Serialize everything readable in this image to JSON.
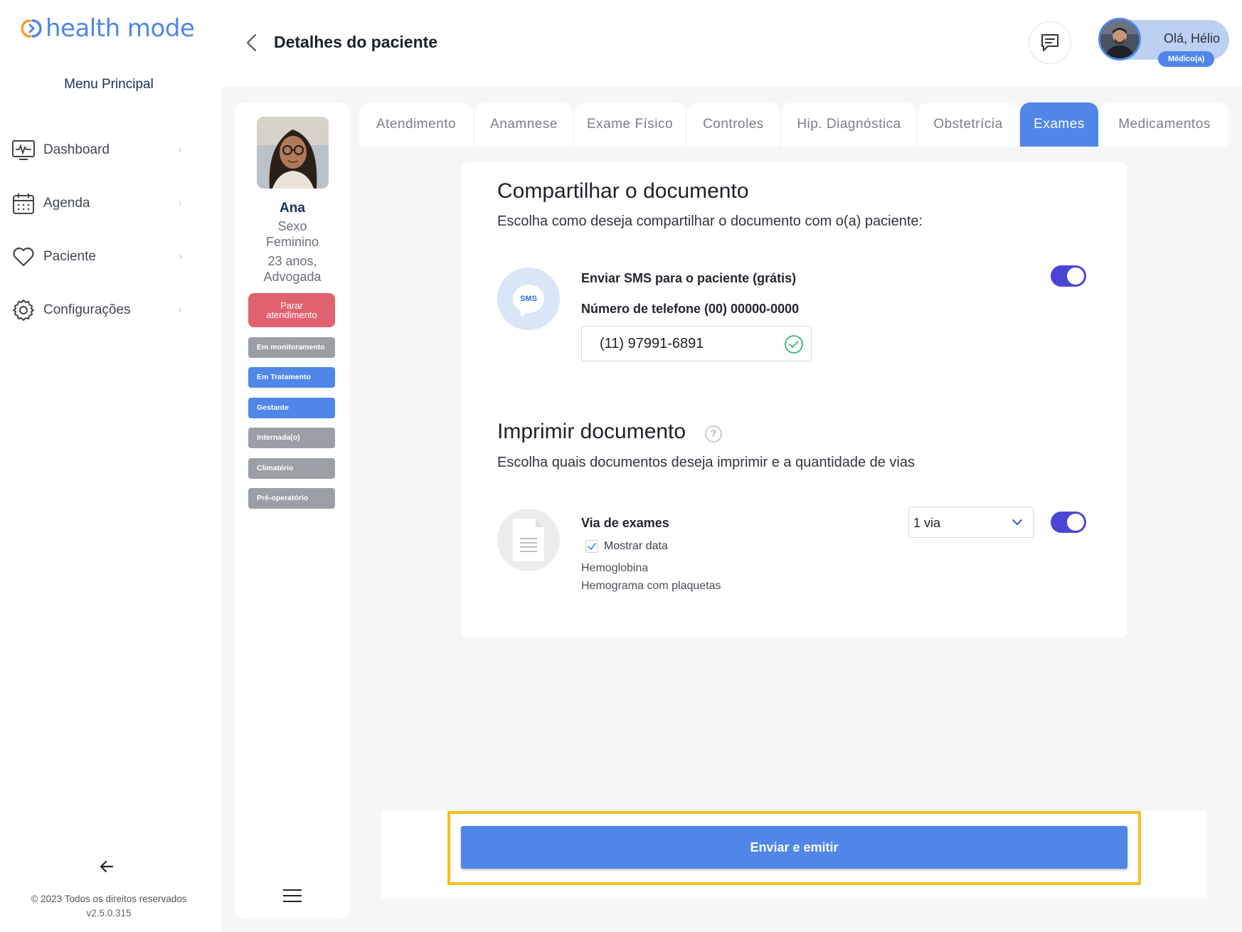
{
  "app": {
    "logo_text": "health mode",
    "menu_title": "Menu Principal",
    "accent_color": "#4f86e8"
  },
  "sidebar": {
    "items": [
      {
        "label": "Dashboard",
        "icon": "monitor-pulse-icon"
      },
      {
        "label": "Agenda",
        "icon": "calendar-icon"
      },
      {
        "label": "Paciente",
        "icon": "heart-icon"
      },
      {
        "label": "Configurações",
        "icon": "gear-icon"
      }
    ],
    "collapse_icon": "arrow-left-icon",
    "copyright": "© 2023 Todos os direitos reservados",
    "version": "v2.5.0.315"
  },
  "header": {
    "title": "Detalhes do paciente",
    "greeting": "Olá, Hélio",
    "role": "Médico(a)"
  },
  "patient": {
    "name": "Ana",
    "sex_line1": "Sexo",
    "sex_line2": "Feminino",
    "age": "23 anos,",
    "occupation": "Advogada",
    "stop_button_line1": "Parar",
    "stop_button_line2": "atendimento",
    "tags": [
      {
        "label": "Em monitoramento",
        "active": false
      },
      {
        "label": "Em Tratamento",
        "active": true
      },
      {
        "label": "Gestante",
        "active": true
      },
      {
        "label": "Internada(o)",
        "active": false
      },
      {
        "label": "Climatério",
        "active": false
      },
      {
        "label": "Pré-operatório",
        "active": false
      }
    ]
  },
  "tabs": [
    {
      "label": "Atendimento",
      "active": false
    },
    {
      "label": "Anamnese",
      "active": false
    },
    {
      "label": "Exame Físico",
      "active": false
    },
    {
      "label": "Controles",
      "active": false
    },
    {
      "label": "Hip. Diagnóstica",
      "active": false
    },
    {
      "label": "Obstetrícia",
      "active": false
    },
    {
      "label": "Exames",
      "active": true
    },
    {
      "label": "Medicamentos",
      "active": false
    }
  ],
  "share": {
    "title": "Compartilhar o documento",
    "subtitle": "Escolha como deseja compartilhar o documento com o(a) paciente:",
    "sms_badge": "SMS",
    "sms_label": "Enviar SMS para o paciente (grátis)",
    "sms_enabled": true,
    "phone_label": "Número de telefone (00) 00000-0000",
    "phone_value": "(11) 97991-6891"
  },
  "print": {
    "title": "Imprimir documento",
    "help_symbol": "?",
    "subtitle": "Escolha quais documentos deseja imprimir e a quantidade de vias",
    "doc_label": "Via de exames",
    "show_date_label": "Mostrar data",
    "show_date_checked": true,
    "exams": [
      "Hemoglobina",
      "Hemograma com plaquetas"
    ],
    "copies_value": "1 via",
    "print_enabled": true
  },
  "actions": {
    "submit_label": "Enviar e emitir"
  }
}
